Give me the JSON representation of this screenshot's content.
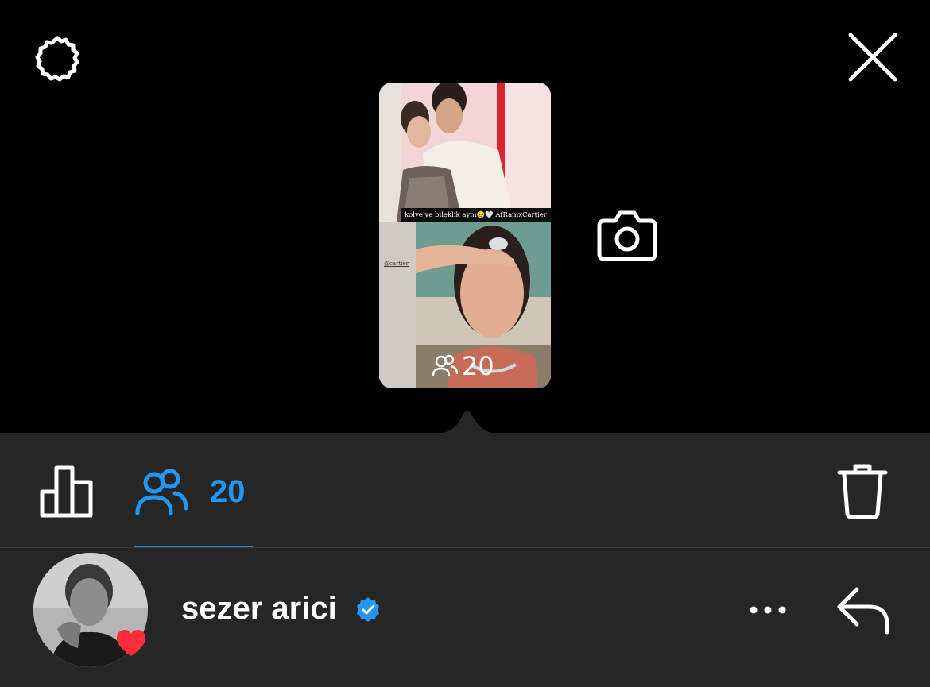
{
  "header": {
    "settings_icon": "gear-icon",
    "close_icon": "close-icon"
  },
  "story": {
    "caption": "kolye ve bileklik aynı🥹🤍 AfRamxCartier",
    "tag": "@cartier",
    "viewer_count": "20"
  },
  "camera_icon": "camera-icon",
  "tabs": {
    "insights_icon": "bar-chart-icon",
    "viewers_icon": "people-icon",
    "viewers_count": "20",
    "delete_icon": "trash-icon"
  },
  "viewer": {
    "name": "sezer arici",
    "verified": true,
    "reaction": "heart",
    "more_icon": "more-horizontal-icon",
    "reply_icon": "reply-icon"
  },
  "colors": {
    "accent_blue": "#2196f3",
    "panel_bg": "#262626",
    "heart_red": "#ff2d3c"
  }
}
